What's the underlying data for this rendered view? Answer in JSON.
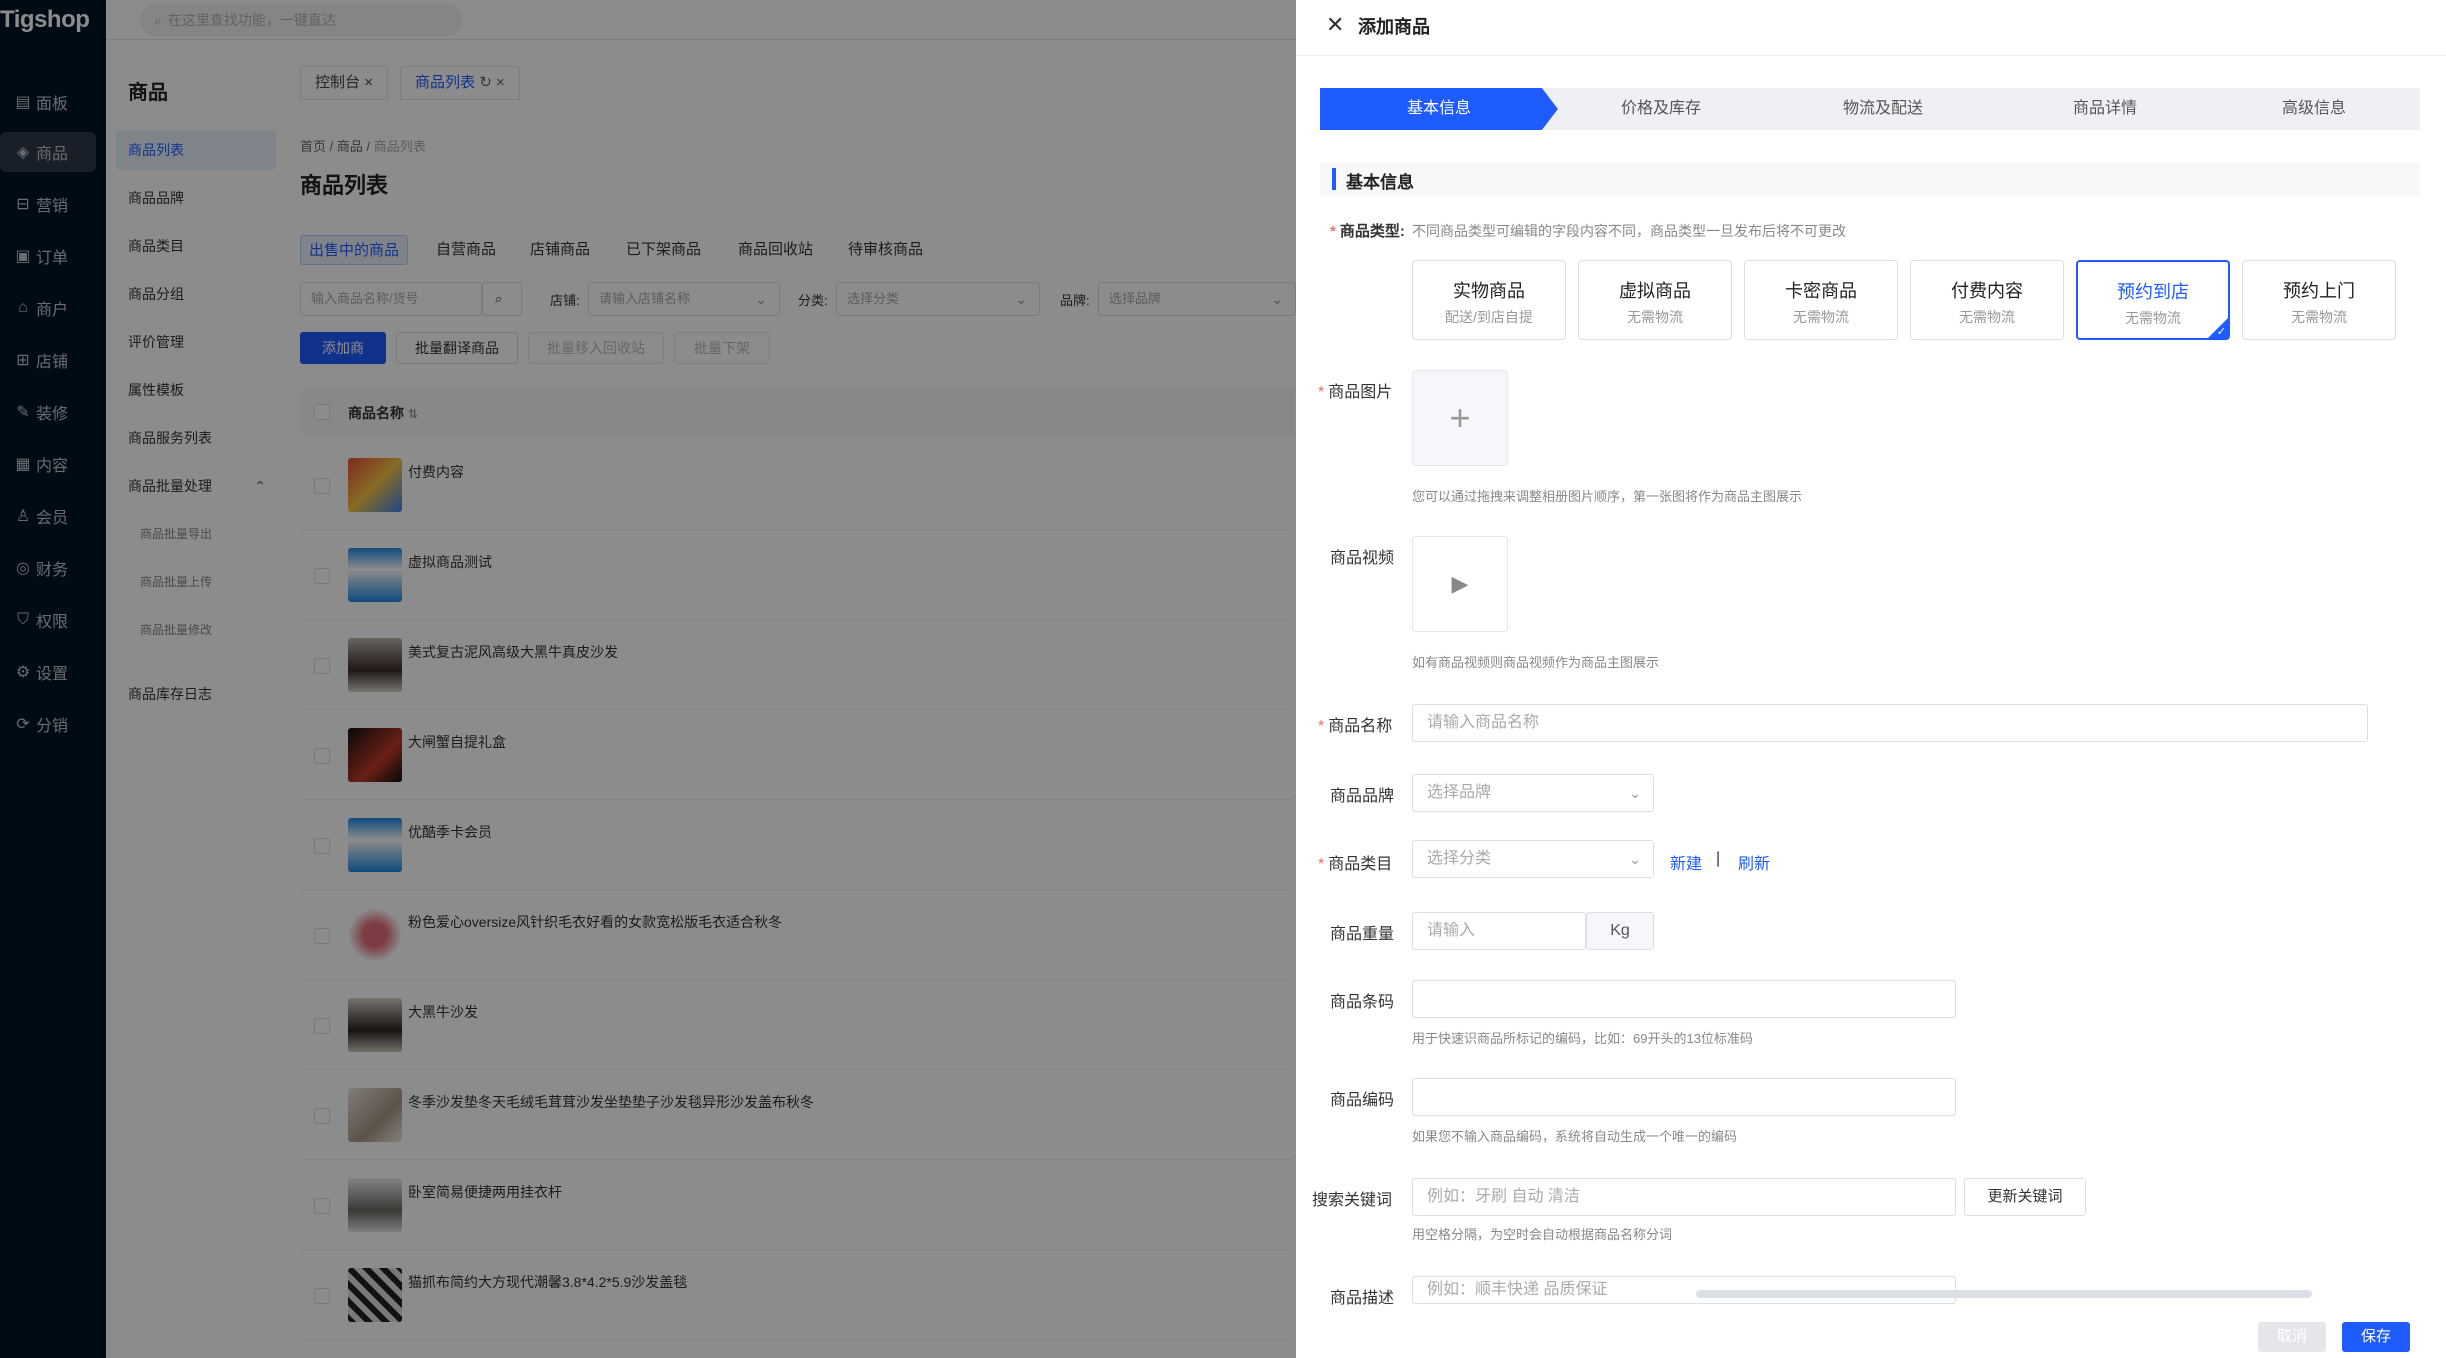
{
  "app": {
    "logo": "Tigshop",
    "search_placeholder": "在这里查找功能，一键直达"
  },
  "nav": {
    "items": [
      {
        "label": "面板",
        "icon": "dashboard-icon"
      },
      {
        "label": "商品",
        "icon": "cube-icon"
      },
      {
        "label": "营销",
        "icon": "gift-icon"
      },
      {
        "label": "订单",
        "icon": "order-icon"
      },
      {
        "label": "商户",
        "icon": "merchant-icon"
      },
      {
        "label": "店铺",
        "icon": "store-icon"
      },
      {
        "label": "装修",
        "icon": "brush-icon"
      },
      {
        "label": "内容",
        "icon": "content-icon"
      },
      {
        "label": "会员",
        "icon": "member-icon"
      },
      {
        "label": "财务",
        "icon": "finance-icon"
      },
      {
        "label": "权限",
        "icon": "shield-icon"
      },
      {
        "label": "设置",
        "icon": "gear-icon"
      },
      {
        "label": "分销",
        "icon": "share-icon"
      }
    ]
  },
  "submenu": {
    "title": "商品",
    "items": [
      "商品列表",
      "商品品牌",
      "商品类目",
      "商品分组",
      "评价管理",
      "属性模板",
      "商品服务列表",
      "商品批量处理"
    ],
    "children": [
      "商品批量导出",
      "商品批量上传",
      "商品批量修改"
    ],
    "last": "商品库存日志"
  },
  "main": {
    "tabs": [
      "控制台",
      "商品列表"
    ],
    "breadcrumb": [
      "首页",
      "商品",
      "商品列表"
    ],
    "title": "商品列表",
    "filter_tabs": [
      "出售中的商品",
      "自营商品",
      "店铺商品",
      "已下架商品",
      "商品回收站",
      "待审核商品"
    ],
    "search_placeholder": "输入商品名称/货号",
    "store_label": "店铺:",
    "store_placeholder": "请输入店铺名称",
    "category_label": "分类:",
    "category_placeholder": "选择分类",
    "brand_label": "品牌:",
    "brand_placeholder": "选择品牌",
    "buttons": [
      "添加商品",
      "批量翻译商品",
      "批量移入回收站",
      "批量下架"
    ],
    "column_header": "商品名称",
    "products": [
      "付费内容",
      "虚拟商品测试",
      "美式复古泥风高级大黑牛真皮沙发",
      "大闸蟹自提礼盒",
      "优酷季卡会员",
      "粉色爱心oversize风针织毛衣好看的女款宽松版毛衣适合秋冬",
      "大黑牛沙发",
      "冬季沙发垫冬天毛绒毛茸茸沙发坐垫垫子沙发毯异形沙发盖布秋冬",
      "卧室简易便捷两用挂衣杆",
      "猫抓布简约大方现代潮馨3.8*4.2*5.9沙发盖毯"
    ]
  },
  "drawer": {
    "title": "添加商品",
    "steps": [
      "基本信息",
      "价格及库存",
      "物流及配送",
      "商品详情",
      "高级信息"
    ],
    "section_title": "基本信息",
    "type_label": "商品类型:",
    "type_hint": "不同商品类型可编辑的字段内容不同，商品类型一旦发布后将不可更改",
    "types": [
      {
        "title": "实物商品",
        "sub": "配送/到店自提"
      },
      {
        "title": "虚拟商品",
        "sub": "无需物流"
      },
      {
        "title": "卡密商品",
        "sub": "无需物流"
      },
      {
        "title": "付费内容",
        "sub": "无需物流"
      },
      {
        "title": "预约到店",
        "sub": "无需物流"
      },
      {
        "title": "预约上门",
        "sub": "无需物流"
      }
    ],
    "image_label": "商品图片",
    "image_hint": "您可以通过拖拽来调整相册图片顺序，第一张图将作为商品主图展示",
    "video_label": "商品视频",
    "video_hint": "如有商品视频则商品视频作为商品主图展示",
    "name_label": "商品名称",
    "name_placeholder": "请输入商品名称",
    "brand_label": "商品品牌",
    "brand_placeholder": "选择品牌",
    "category_label": "商品类目",
    "category_placeholder": "选择分类",
    "new_link": "新建",
    "separator": "|",
    "refresh_link": "刷新",
    "weight_label": "商品重量",
    "weight_placeholder": "请输入",
    "weight_unit": "Kg",
    "barcode_label": "商品条码",
    "barcode_hint": "用于快速识商品所标记的编码，比如：69开头的13位标准码",
    "sn_label": "商品编码",
    "sn_hint": "如果您不输入商品编码，系统将自动生成一个唯一的编码",
    "keyword_label": "搜索关键词",
    "keyword_placeholder": "例如：牙刷 自动 清洁",
    "keyword_button": "更新关键词",
    "keyword_hint": "用空格分隔，为空时会自动根据商品名称分词",
    "desc_label": "商品描述",
    "desc_placeholder": "例如：顺丰快递 品质保证",
    "cancel": "取消",
    "save": "保存"
  },
  "colors": {
    "primary": "#1f5cff",
    "nav_bg": "#001529"
  }
}
